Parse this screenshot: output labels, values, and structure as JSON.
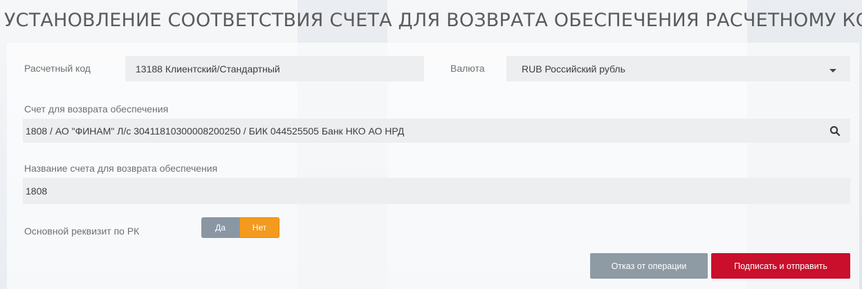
{
  "title": "УСТАНОВЛЕНИЕ СООТВЕТСТВИЯ СЧЕТА ДЛЯ ВОЗВРАТА ОБЕСПЕЧЕНИЯ РАСЧЕТНОМУ КОДУ",
  "form": {
    "settlement_code": {
      "label": "Расчетный код",
      "value": "13188 Клиентский/Стандартный"
    },
    "currency": {
      "label": "Валюта",
      "value": "RUB Российский рубль",
      "icon": "chevron-down-icon"
    },
    "return_account": {
      "label": "Счет для возврата обеспечения",
      "value": "1808 / АО \"ФИНАМ\" Л/с 30411810300008200250 / БИК 044525505 Банк НКО АО НРД",
      "icon": "search-icon"
    },
    "return_account_name": {
      "label": "Название счета для возврата обеспечения",
      "value": "1808"
    },
    "main_requisite": {
      "label": "Основной реквизит по РК",
      "options": [
        "Да",
        "Нет"
      ],
      "selected": "Нет"
    }
  },
  "actions": {
    "cancel_label": "Отказ от операции",
    "submit_label": "Подписать и отправить"
  },
  "colors": {
    "accent_orange": "#f39a1f",
    "submit_red": "#c90f2c",
    "neutral_gray": "#8e9aa4",
    "field_bg": "#eceeef"
  }
}
